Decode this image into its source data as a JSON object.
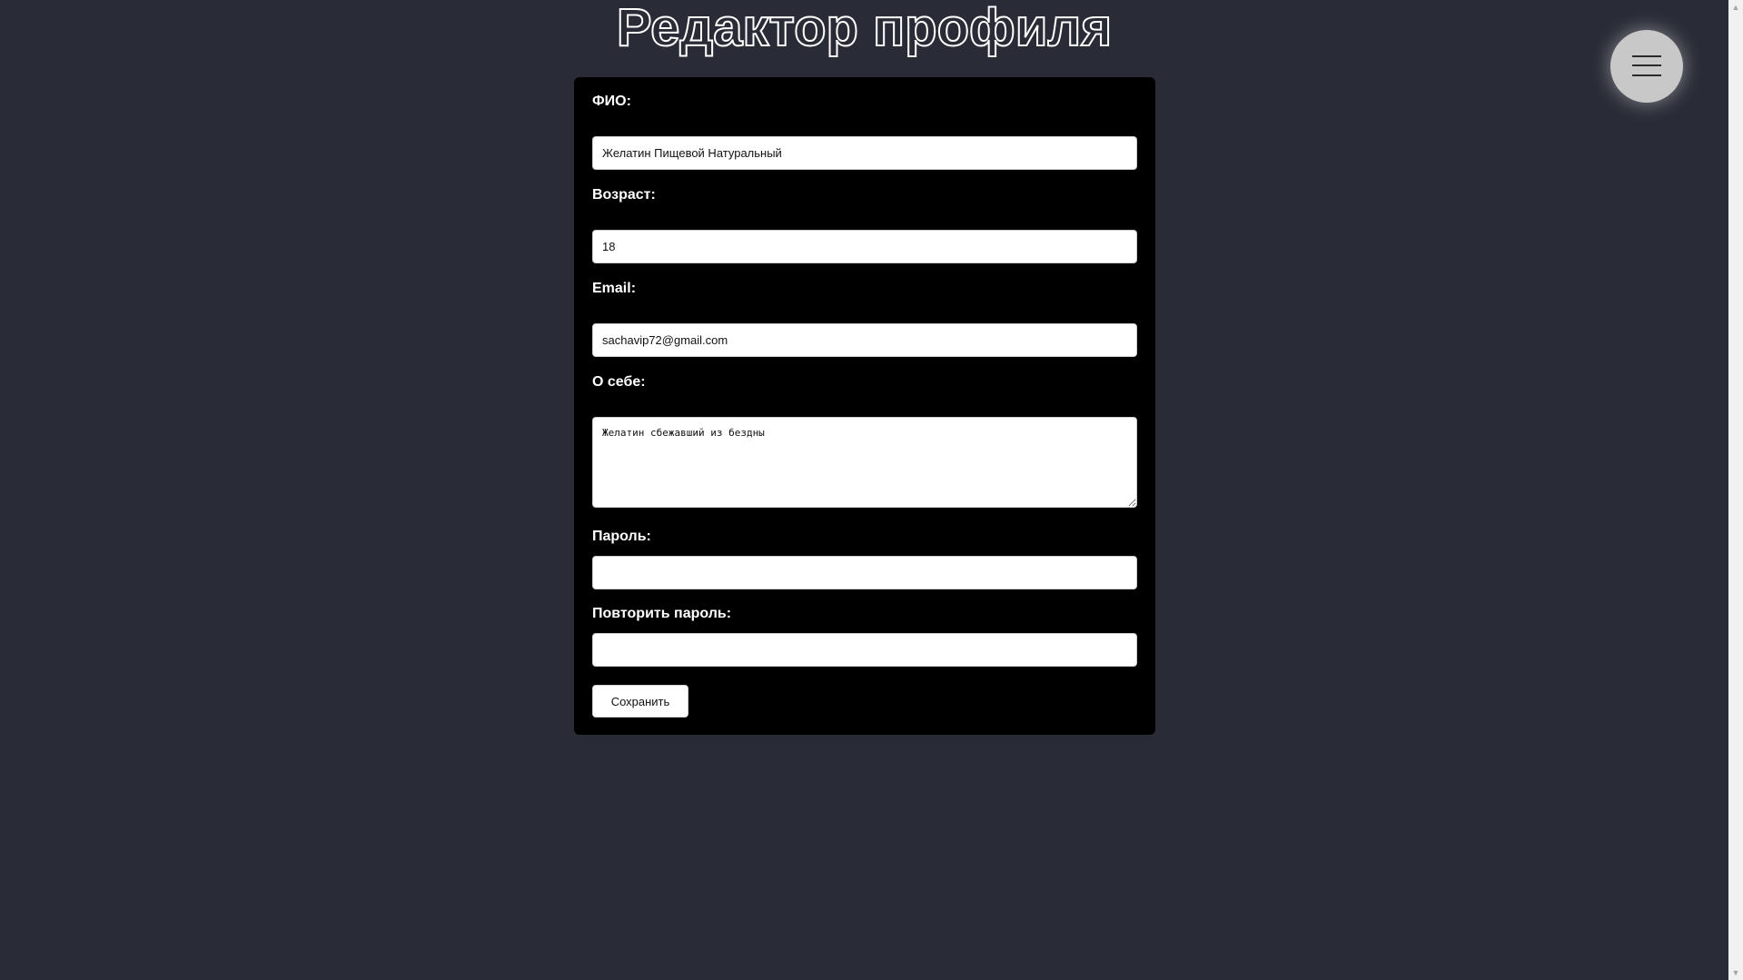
{
  "page": {
    "title": "Редактор профиля"
  },
  "menu": {
    "icon": "hamburger-menu-icon"
  },
  "form": {
    "full_name": {
      "label": "ФИО:",
      "value": "Желатин Пищевой Натуральный"
    },
    "age": {
      "label": "Возраст:",
      "value": "18"
    },
    "email": {
      "label": "Email:",
      "value": "sachavip72@gmail.com"
    },
    "about": {
      "label": "О себе:",
      "value": "Желатин сбежавший из бездны"
    },
    "password": {
      "label": "Пароль:",
      "value": ""
    },
    "repeat_password": {
      "label": "Повторить пароль:",
      "value": ""
    },
    "save_label": "Сохранить"
  },
  "colors": {
    "background": "#292b36",
    "card": "#000000",
    "text": "#ffffff"
  }
}
